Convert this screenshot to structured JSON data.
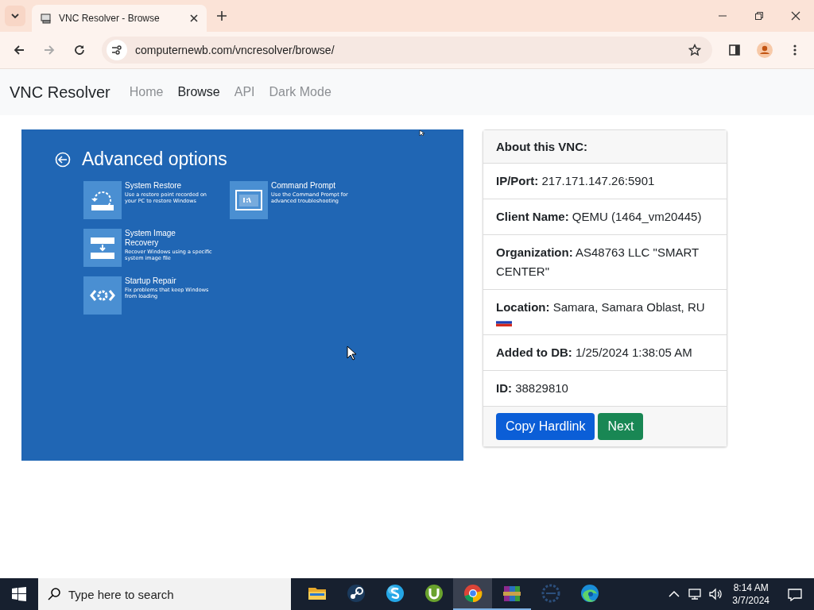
{
  "browser": {
    "tabs": [
      {
        "title": "VNC Resolver - Browse",
        "selected": true
      }
    ],
    "url": "computernewb.com/vncresolver/browse/",
    "forward_disabled": true
  },
  "site": {
    "brand": "VNC Resolver",
    "nav": [
      {
        "label": "Home",
        "selected": false
      },
      {
        "label": "Browse",
        "selected": true
      },
      {
        "label": "API",
        "selected": false
      },
      {
        "label": "Dark Mode",
        "selected": false
      }
    ]
  },
  "vnc_screen": {
    "title": "Advanced options",
    "option_columns": [
      [
        {
          "kind": "restore",
          "title": "System Restore",
          "description": "Use a restore point recorded on your PC to restore Windows"
        },
        {
          "kind": "image",
          "title": "System Image Recovery",
          "description": "Recover Windows using a specific system image file"
        },
        {
          "kind": "repair",
          "title": "Startup Repair",
          "description": "Fix problems that keep Windows from loading"
        }
      ],
      [
        {
          "kind": "cmd",
          "title": "Command Prompt",
          "description": "Use the Command Prompt for advanced troubleshooting"
        }
      ]
    ]
  },
  "card": {
    "header": "About this VNC:",
    "rows": [
      {
        "text": "**IP/Port:** 217.171.147.26:5901"
      },
      {
        "text": "**Client Name:** QEMU (1464_vm20445)"
      },
      {
        "text": "**Organization:** AS48763 LLC \"SMART CENTER\""
      },
      {
        "text": "**Location:** Samara, Samara Oblast, RU",
        "flag": true
      },
      {
        "text": "**Added to DB:** 1/25/2024 1:38:05 AM"
      },
      {
        "text": "**ID:** 38829810"
      }
    ],
    "buttons": [
      {
        "label": "Copy Hardlink",
        "kind": "primary"
      },
      {
        "label": "Next",
        "kind": "success"
      }
    ]
  },
  "taskbar": {
    "search_placeholder": "Type here to search",
    "apps": [
      {
        "kind": "folder",
        "selected": false,
        "running": false
      },
      {
        "kind": "steam",
        "selected": false,
        "running": false
      },
      {
        "kind": "skype",
        "selected": false,
        "running": false
      },
      {
        "kind": "torrent",
        "selected": false,
        "running": false
      },
      {
        "kind": "chrome",
        "selected": true,
        "running": true
      },
      {
        "kind": "archive",
        "selected": false,
        "running": true
      },
      {
        "kind": "eclipse",
        "selected": false,
        "running": false
      },
      {
        "kind": "edge",
        "selected": false,
        "running": false
      }
    ],
    "time": "8:14 AM",
    "date": "3/7/2024"
  }
}
